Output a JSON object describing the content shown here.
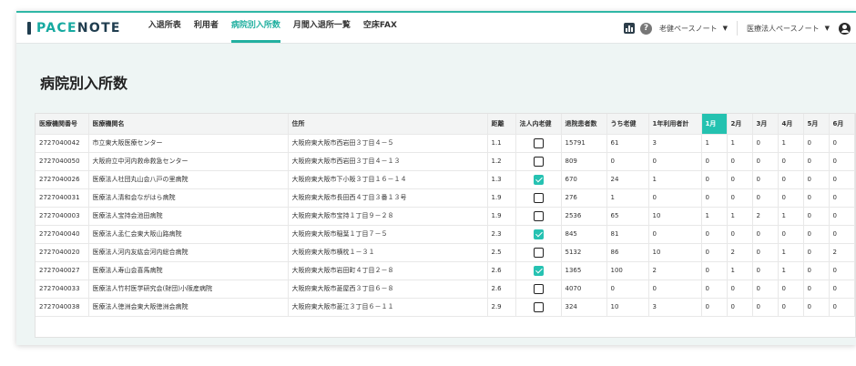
{
  "app": {
    "logo_pace": "PACE",
    "logo_note": "NOTE",
    "nav": [
      {
        "label": "入退所表",
        "active": false
      },
      {
        "label": "利用者",
        "active": false
      },
      {
        "label": "病院別入所数",
        "active": true
      },
      {
        "label": "月間入退所一覧",
        "active": false
      },
      {
        "label": "空床FAX",
        "active": false
      }
    ],
    "help_label": "?",
    "account_1": "老健ペースノート",
    "account_2": "医療法人ペースノート"
  },
  "page": {
    "title": "病院別入所数"
  },
  "table": {
    "headers": [
      "医療機関番号",
      "医療機関名",
      "住所",
      "距離",
      "法人内老健",
      "退院患者数",
      "うち老健",
      "1年利用者計",
      "1月",
      "2月",
      "3月",
      "4月",
      "5月",
      "6月"
    ],
    "active_month": "1月",
    "rows": [
      {
        "code": "2727040042",
        "name": "市立東大阪医療センター",
        "address": "大阪府東大阪市西岩田３丁目４－５",
        "distance": "1.1",
        "in_corp": false,
        "discharged": "15791",
        "roken": "61",
        "year_total": "3",
        "months": [
          "1",
          "1",
          "0",
          "1",
          "0",
          "0"
        ]
      },
      {
        "code": "2727040050",
        "name": "大阪府立中河内救命救急センター",
        "address": "大阪府東大阪市西岩田３丁目４－１３",
        "distance": "1.2",
        "in_corp": false,
        "discharged": "809",
        "roken": "0",
        "year_total": "0",
        "months": [
          "0",
          "0",
          "0",
          "0",
          "0",
          "0"
        ]
      },
      {
        "code": "2727040026",
        "name": "医療法人社団丸山会八戸の里病院",
        "address": "大阪府東大阪市下小阪３丁目１６－１４",
        "distance": "1.3",
        "in_corp": true,
        "discharged": "670",
        "roken": "24",
        "year_total": "1",
        "months": [
          "0",
          "0",
          "0",
          "0",
          "0",
          "0"
        ]
      },
      {
        "code": "2727040031",
        "name": "医療法人清和会ながはら病院",
        "address": "大阪府東大阪市長田西４丁目３番１３号",
        "distance": "1.9",
        "in_corp": false,
        "discharged": "276",
        "roken": "1",
        "year_total": "0",
        "months": [
          "0",
          "0",
          "0",
          "0",
          "0",
          "0"
        ]
      },
      {
        "code": "2727040003",
        "name": "医療法人宝持会池田病院",
        "address": "大阪府東大阪市宝持１丁目９－２８",
        "distance": "1.9",
        "in_corp": false,
        "discharged": "2536",
        "roken": "65",
        "year_total": "10",
        "months": [
          "1",
          "1",
          "2",
          "1",
          "0",
          "0"
        ]
      },
      {
        "code": "2727040040",
        "name": "医療法人孟仁会東大阪山路病院",
        "address": "大阪府東大阪市稲葉１丁目７－５",
        "distance": "2.3",
        "in_corp": true,
        "discharged": "845",
        "roken": "81",
        "year_total": "0",
        "months": [
          "0",
          "0",
          "0",
          "0",
          "0",
          "0"
        ]
      },
      {
        "code": "2727040020",
        "name": "医療法人河内友紘会河内総合病院",
        "address": "大阪府東大阪市横枕１－３１",
        "distance": "2.5",
        "in_corp": false,
        "discharged": "5132",
        "roken": "86",
        "year_total": "10",
        "months": [
          "0",
          "2",
          "0",
          "1",
          "0",
          "2"
        ]
      },
      {
        "code": "2727040027",
        "name": "医療法人寿山会喜馬病院",
        "address": "大阪府東大阪市岩田町４丁目２－８",
        "distance": "2.6",
        "in_corp": true,
        "discharged": "1365",
        "roken": "100",
        "year_total": "2",
        "months": [
          "0",
          "1",
          "0",
          "1",
          "0",
          "0"
        ]
      },
      {
        "code": "2727040033",
        "name": "医療法人竹村医学研究会(財団)小阪産病院",
        "address": "大阪府東大阪市菱屋西３丁目６－８",
        "distance": "2.6",
        "in_corp": false,
        "discharged": "4070",
        "roken": "0",
        "year_total": "0",
        "months": [
          "0",
          "0",
          "0",
          "0",
          "0",
          "0"
        ]
      },
      {
        "code": "2727040038",
        "name": "医療法人徳洲会東大阪徳洲会病院",
        "address": "大阪府東大阪市菱江３丁目６－１１",
        "distance": "2.9",
        "in_corp": false,
        "discharged": "324",
        "roken": "10",
        "year_total": "3",
        "months": [
          "0",
          "0",
          "0",
          "0",
          "0",
          "0"
        ]
      }
    ]
  },
  "colors": {
    "accent": "#24c2b0",
    "logo_dark": "#1f3d4f",
    "page_bg": "#eef5f4"
  }
}
